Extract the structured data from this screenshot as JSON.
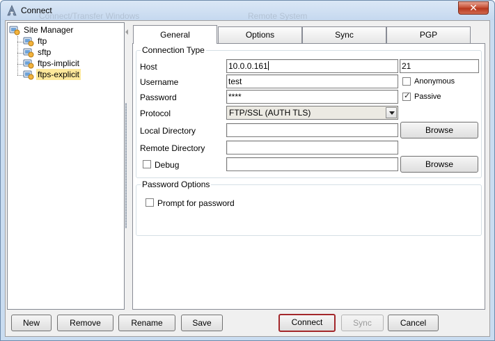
{
  "window": {
    "title": "Connect",
    "close_glyph": "✕",
    "background_text": [
      "Connect/Transfer Windows",
      "Remote System"
    ]
  },
  "tree": {
    "root": "Site Manager",
    "sites": [
      {
        "label": "ftp",
        "selected": false
      },
      {
        "label": "sftp",
        "selected": false
      },
      {
        "label": "ftps-implicit",
        "selected": false
      },
      {
        "label": "ftps-explicit",
        "selected": true
      }
    ]
  },
  "tabs": [
    {
      "label": "General",
      "active": true
    },
    {
      "label": "Options",
      "active": false
    },
    {
      "label": "Sync",
      "active": false
    },
    {
      "label": "PGP",
      "active": false
    }
  ],
  "connection": {
    "legend": "Connection Type",
    "host_label": "Host",
    "host_value": "10.0.0.161",
    "port_value": "21",
    "username_label": "Username",
    "username_value": "test",
    "anonymous_label": "Anonymous",
    "anonymous_checked": false,
    "password_label": "Password",
    "password_value": "****",
    "passive_label": "Passive",
    "passive_checked": true,
    "protocol_label": "Protocol",
    "protocol_value": "FTP/SSL (AUTH TLS)",
    "local_dir_label": "Local Directory",
    "local_dir_value": "",
    "remote_dir_label": "Remote Directory",
    "remote_dir_value": "",
    "debug_label": "Debug",
    "debug_checked": false,
    "debug_value": "",
    "browse_label": "Browse"
  },
  "password_options": {
    "legend": "Password Options",
    "prompt_label": "Prompt for password",
    "prompt_checked": false
  },
  "buttons": {
    "new": "New",
    "remove": "Remove",
    "rename": "Rename",
    "save": "Save",
    "connect": "Connect",
    "sync": "Sync",
    "cancel": "Cancel"
  },
  "colors": {
    "window_frame": "#c9dcf0",
    "selection": "#fde89a",
    "default_button_border": "#a3272b",
    "close_button": "#c44a2f"
  }
}
